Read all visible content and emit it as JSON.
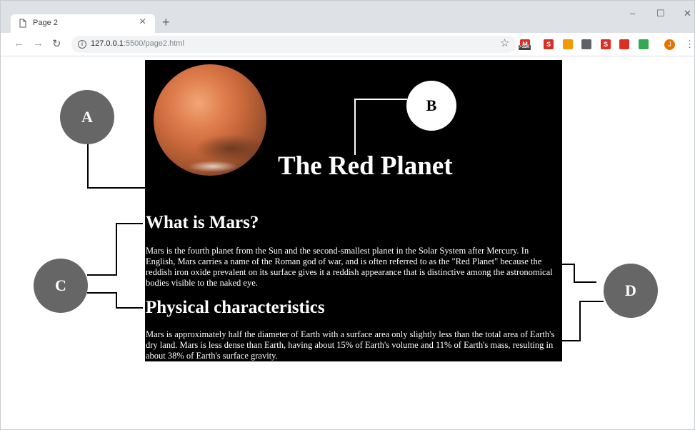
{
  "browser": {
    "tab_title": "Page 2",
    "tab_close": "×",
    "new_tab": "+",
    "minimize": "–",
    "maximize": "☐",
    "close": "✕",
    "url_host": "127.0.0.1",
    "url_path": ":5500/page2.html",
    "extensions": [
      {
        "name": "gmail-extension",
        "label": "M",
        "badge": ">15K",
        "color": "#d93025"
      },
      {
        "name": "s-extension-1",
        "label": "S",
        "color": "#d93025"
      },
      {
        "name": "circle-extension",
        "label": "",
        "color": "#f29900"
      },
      {
        "name": "shield-extension",
        "label": "",
        "color": "#5f6368"
      },
      {
        "name": "s-extension-2",
        "label": "S",
        "color": "#d93025"
      },
      {
        "name": "red-extension",
        "label": "",
        "color": "#d93025"
      },
      {
        "name": "color-extension",
        "label": "",
        "color": "#34a853"
      }
    ],
    "avatar_letter": "J"
  },
  "page": {
    "title": "The Red Planet",
    "section1_heading": "What is Mars?",
    "section1_text": "Mars is the fourth planet from the Sun and the second-smallest planet in the Solar System after Mercury. In English, Mars carries a name of the Roman god of war, and is often referred to as the \"Red Planet\" because the reddish iron oxide prevalent on its surface gives it a reddish appearance that is distinctive among the astronomical bodies visible to the naked eye.",
    "section2_heading": "Physical characteristics",
    "section2_text": "Mars is approximately half the diameter of Earth with a surface area only slightly less than the total area of Earth's dry land. Mars is less dense than Earth, having about 15% of Earth's volume and 11% of Earth's mass, resulting in about 38% of Earth's surface gravity."
  },
  "callouts": {
    "a": "A",
    "b": "B",
    "c": "C",
    "d": "D"
  }
}
